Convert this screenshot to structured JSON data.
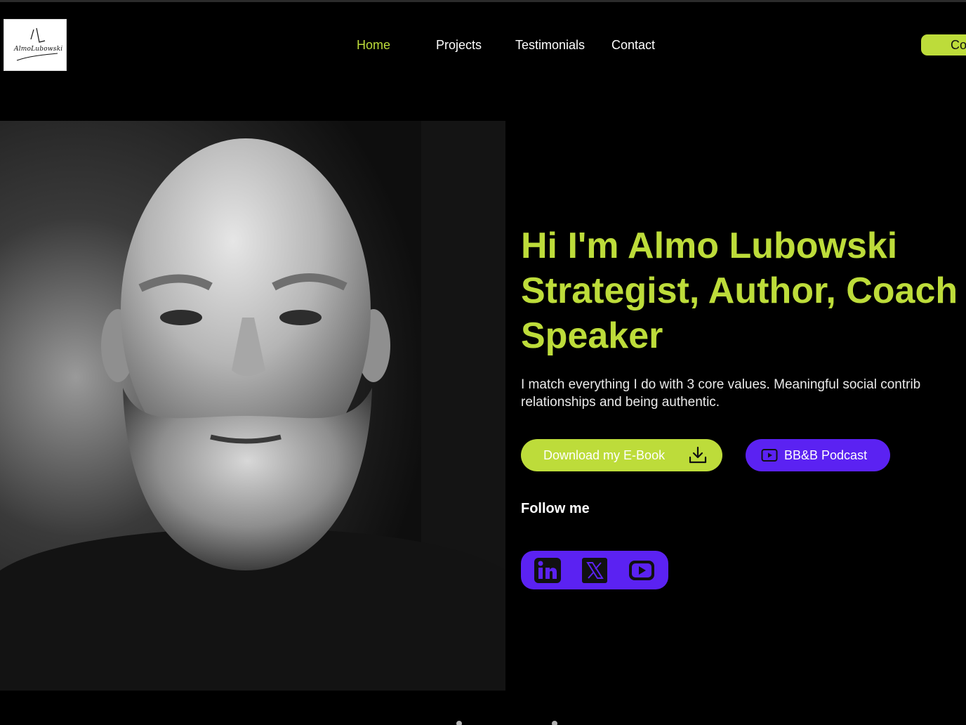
{
  "logo": {
    "mark": "AL",
    "text": "AlmoLubowski"
  },
  "nav": {
    "items": [
      {
        "label": "Home",
        "active": true
      },
      {
        "label": "Projects",
        "active": false
      },
      {
        "label": "Testimonials",
        "active": false
      },
      {
        "label": "Contact",
        "active": false
      }
    ]
  },
  "header": {
    "contact_button": "Co"
  },
  "hero": {
    "headline": [
      "Hi I'm Almo Lubowski",
      "Strategist, Author, Coach",
      "Speaker"
    ],
    "intro": [
      "I match everything I do with 3 core values. Meaningful social contrib",
      "relationships and being authentic."
    ],
    "ebook_button": "Download my E-Book",
    "ebook_icon": "download-icon",
    "podcast_button": "BB&B Podcast",
    "podcast_icon": "play-icon",
    "follow_label": "Follow me",
    "socials": [
      {
        "icon": "linkedin-icon"
      },
      {
        "icon": "x-icon"
      },
      {
        "icon": "youtube-icon"
      }
    ]
  },
  "colors": {
    "accent": "#bddc3a",
    "purple": "#5b22f2",
    "background": "#000000"
  }
}
